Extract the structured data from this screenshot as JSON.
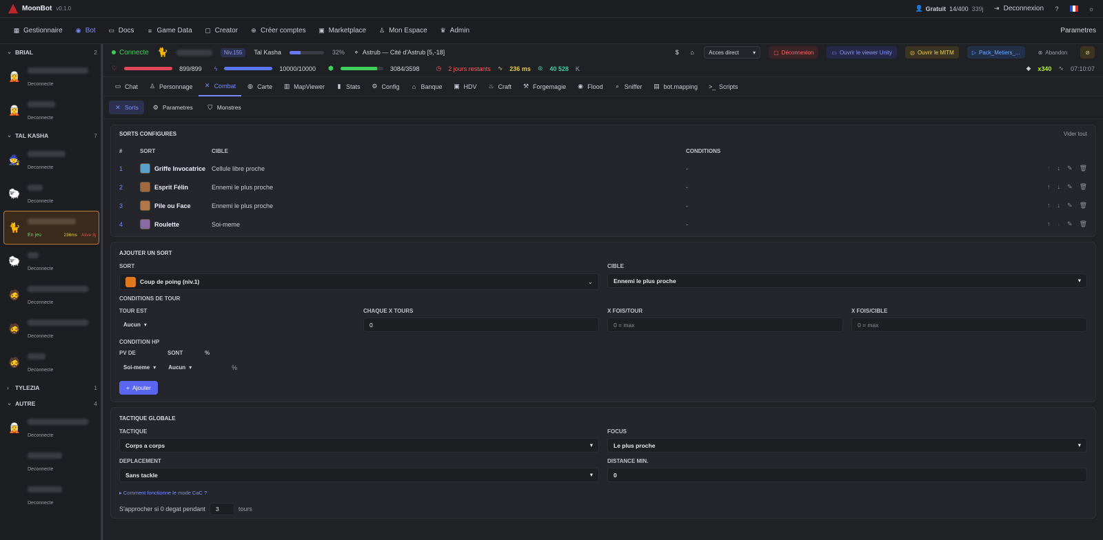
{
  "app": {
    "name": "MoonBot",
    "version": "v0.1.0"
  },
  "top": {
    "plan": "Gratuit",
    "quota": "14/400",
    "days": "339j",
    "logout": "Deconnexion"
  },
  "nav": {
    "items": [
      "Gestionnaire",
      "Bot",
      "Docs",
      "Game Data",
      "Creator",
      "Créer comptes",
      "Marketplace",
      "Mon Espace",
      "Admin"
    ],
    "right": "Parametres"
  },
  "sidebar": {
    "groups": [
      {
        "name": "BRIAL",
        "count": "2",
        "accounts": [
          {
            "status": "Deconnecte"
          },
          {
            "status": "Deconnecte"
          }
        ]
      },
      {
        "name": "TAL KASHA",
        "count": "7",
        "accounts": [
          {
            "status": "Deconnecte"
          },
          {
            "status": "Deconnecte"
          },
          {
            "status": "En jeu",
            "ping": "236ms",
            "alert": "Alive 3j"
          },
          {
            "status": "Deconnecte"
          },
          {
            "status": "Deconnecte"
          },
          {
            "status": "Deconnecte"
          },
          {
            "status": "Deconnecte"
          }
        ]
      },
      {
        "name": "TYLEZIA",
        "count": "1"
      },
      {
        "name": "AUTRE",
        "count": "4",
        "accounts": [
          {
            "status": "Deconnecte"
          },
          {
            "status": "Deconnecte"
          },
          {
            "status": "Deconnecte"
          }
        ]
      }
    ]
  },
  "char": {
    "status": "Connecte",
    "level": "Niv.155",
    "server": "Tal Kasha",
    "xp_pct": "32%",
    "xp_fraction": 0.32,
    "location": "Astrub — Cité d'Astrub [5,-18]",
    "access": "Acces direct",
    "disconnect": "Déconnexion",
    "viewer": "Ouvrir le viewer Unity",
    "mitm": "Ouvrir le MITM",
    "pack": "Pack_Metiers_...",
    "abandon": "Abandon",
    "hp": "899/899",
    "hp_fraction": 1,
    "energy": "10000/10000",
    "energy_fraction": 1,
    "pods": "3084/3598",
    "pods_fraction": 0.857,
    "days_left": "2 jours restants",
    "ping": "236 ms",
    "kamas": "40 528",
    "kamas_unit": "K",
    "gems": "x340",
    "time": "07:10:07"
  },
  "tabs": [
    "Chat",
    "Personnage",
    "Combat",
    "Carte",
    "MapViewer",
    "Stats",
    "Config",
    "Banque",
    "HDV",
    "Craft",
    "Forgemagie",
    "Flood",
    "Sniffer",
    "bot.mapping",
    "Scripts"
  ],
  "subtabs": [
    "Sorts",
    "Parametres",
    "Monstres"
  ],
  "sorts": {
    "title": "SORTS CONFIGURES",
    "clear": "Vider tout",
    "headers": [
      "#",
      "SORT",
      "CIBLE",
      "CONDITIONS"
    ],
    "rows": [
      {
        "n": "1",
        "name": "Griffe Invocatrice",
        "target": "Cellule libre proche",
        "cond": "-"
      },
      {
        "n": "2",
        "name": "Esprit Félin",
        "target": "Ennemi le plus proche",
        "cond": "-"
      },
      {
        "n": "3",
        "name": "Pile ou Face",
        "target": "Ennemi le plus proche",
        "cond": "-"
      },
      {
        "n": "4",
        "name": "Roulette",
        "target": "Soi-meme",
        "cond": "-"
      }
    ]
  },
  "add": {
    "title": "AJOUTER UN SORT",
    "sort_label": "SORT",
    "sort_value": "Coup de poing (niv.1)",
    "cible_label": "CIBLE",
    "cible_value": "Ennemi le plus proche",
    "tour_title": "CONDITIONS DE TOUR",
    "tour_est": "TOUR EST",
    "tour_est_val": "Aucun",
    "chaque": "CHAQUE X TOURS",
    "chaque_val": "0",
    "xfois": "X FOIS/TOUR",
    "xfois_ph": "0 = max",
    "xcible": "X FOIS/CIBLE",
    "xcible_ph": "0 = max",
    "hp_title": "CONDITION HP",
    "pv_de": "PV DE",
    "sont": "SONT",
    "pct": "%",
    "pv_val": "Soi-meme",
    "sont_val": "Aucun",
    "pct2": "%",
    "button": "Ajouter"
  },
  "tactic": {
    "title": "TACTIQUE GLOBALE",
    "tactique": "TACTIQUE",
    "tactique_val": "Corps a corps",
    "focus": "FOCUS",
    "focus_val": "Le plus proche",
    "deplacement": "DEPLACEMENT",
    "deplacement_val": "Sans tackle",
    "distance": "DISTANCE MIN.",
    "distance_val": "0",
    "help": "Comment fonctionne le mode CaC ?",
    "approach": "S'approcher si 0 degat pendant",
    "approach_val": "3",
    "tours": "tours"
  }
}
